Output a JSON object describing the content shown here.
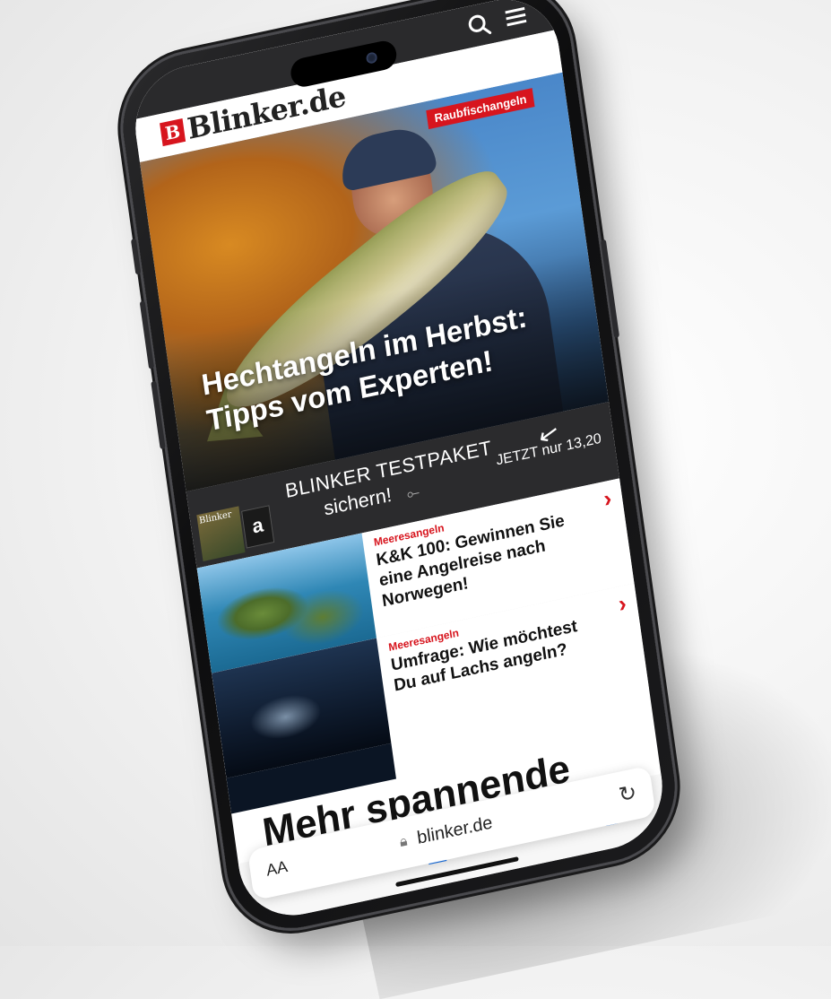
{
  "header": {
    "logo_mark": "B",
    "logo_text": "Blinker.de",
    "search_icon": "search-icon",
    "menu_icon": "hamburger-menu-icon"
  },
  "hero": {
    "badge": "Raubfischangeln",
    "headline": "Hechtangeln im Herbst: Tipps vom Experten!"
  },
  "banner": {
    "line1": "BLINKER TESTPAKET",
    "line2": "sichern!",
    "cta": "JETZT nur 13,20",
    "thumb_label": "Blinker",
    "amazon_glyph": "a"
  },
  "articles": [
    {
      "category": "Meeresangeln",
      "title": "K&K 100: Gewinnen Sie eine Angelreise nach Norwegen!"
    },
    {
      "category": "Meeresangeln",
      "title": "Umfrage: Wie möchtest Du auf Lachs angeln?"
    }
  ],
  "section": {
    "title": "Mehr spannende Beiträge"
  },
  "safari": {
    "text_size": "AA",
    "url": "blinker.de",
    "reload_icon": "reload-icon",
    "tabs": [
      "back-icon",
      "forward-icon",
      "share-icon",
      "bookmarks-icon",
      "tabs-icon"
    ]
  },
  "colors": {
    "brand_red": "#d7151e",
    "ios_blue": "#1a73e8",
    "banner_bg": "#2b2b2d"
  }
}
